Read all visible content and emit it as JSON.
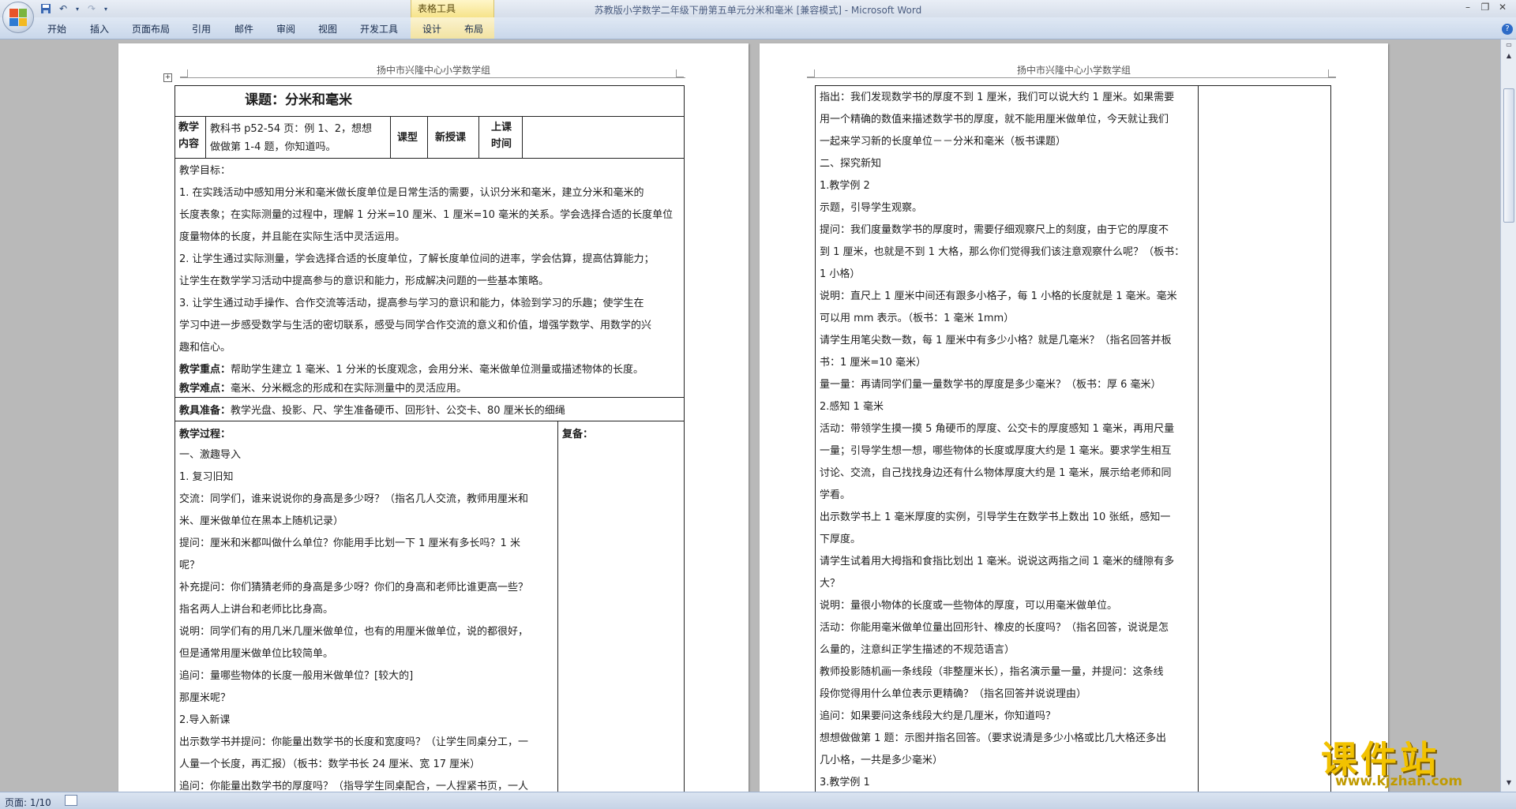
{
  "window": {
    "title": "苏教版小学数学二年级下册第五单元分米和毫米 [兼容模式] - Microsoft Word",
    "context_tab_group": "表格工具"
  },
  "ribbon": {
    "tabs": [
      "开始",
      "插入",
      "页面布局",
      "引用",
      "邮件",
      "审阅",
      "视图",
      "开发工具",
      "设计",
      "布局"
    ]
  },
  "page1": {
    "header": "扬中市兴隆中心小学数学组",
    "title": "课题：分米和毫米",
    "row2": {
      "label_a": "教学",
      "label_b": "内容",
      "content_a": "教科书 p52-54 页：例 1、2，想想",
      "content_b": "做做第 1-4 题，你知道吗。",
      "lesson_type_label": "课型",
      "lesson_type_value": "新授课",
      "time_label_a": "上课",
      "time_label_b": "时间"
    },
    "objectives_heading": "教学目标：",
    "objectives": [
      "1. 在实践活动中感知用分米和毫米做长度单位是日常生活的需要，认识分米和毫米，建立分米和毫米的",
      "长度表象；在实际测量的过程中，理解 1 分米=10 厘米、1 厘米=10 毫米的关系。学会选择合适的长度单位",
      "度量物体的长度，并且能在实际生活中灵活运用。",
      "2. 让学生通过实际测量，学会选择合适的长度单位，了解长度单位间的进率，学会估算，提高估算能力；",
      "让学生在数学学习活动中提高参与的意识和能力，形成解决问题的一些基本策略。",
      "3. 让学生通过动手操作、合作交流等活动，提高参与学习的意识和能力，体验到学习的乐趣；使学生在",
      "学习中进一步感受数学与生活的密切联系，感受与同学合作交流的意义和价值，增强学数学、用数学的兴",
      "趣和信心。"
    ],
    "key_point_label": "教学重点：",
    "key_point": "帮助学生建立 1 毫米、1 分米的长度观念，会用分米、毫米做单位测量或描述物体的长度。",
    "difficulty_label": "教学难点：",
    "difficulty": "毫米、分米概念的形成和在实际测量中的灵活应用。",
    "prep_label": "教具准备：",
    "prep": "教学光盘、投影、尺、学生准备硬币、回形针、公交卡、80 厘米长的细绳",
    "process_label": "教学过程：",
    "review_label": "复备：",
    "process": [
      "一、激趣导入",
      "1. 复习旧知",
      "交流：同学们，谁来说说你的身高是多少呀？（指名几人交流，教师用厘米和",
      "米、厘米做单位在黑本上随机记录）",
      "提问：厘米和米都叫做什么单位？你能用手比划一下  1  厘米有多长吗？1 米",
      "呢？",
      "补充提问：你们猜猜老师的身高是多少呀？你们的身高和老师比谁更高一些？",
      "指名两人上讲台和老师比比身高。",
      "说明：同学们有的用几米几厘米做单位，也有的用厘米做单位，说的都很好，",
      "但是通常用厘米做单位比较简单。",
      "追问：量哪些物体的长度一般用米做单位？[较大的]",
      "那厘米呢？",
      "2.导入新课",
      "出示数学书并提问：你能量出数学书的长度和宽度吗？（让学生同桌分工，一",
      "人量一个长度，再汇报）（板书：数学书长 24 厘米、宽 17 厘米）",
      "追问：你能量出数学书的厚度吗？（指导学生同桌配合，一人捏紧书页，一人"
    ]
  },
  "page2": {
    "header": "扬中市兴隆中心小学数学组",
    "lines": [
      "指出：我们发现数学书的厚度不到 1 厘米，我们可以说大约 1 厘米。如果需要",
      "用一个精确的数值来描述数学书的厚度，就不能用厘米做单位，今天就让我们",
      "一起来学习新的长度单位－－分米和毫米（板书课题）",
      "二、探究新知",
      "1.教学例 2",
      "示题，引导学生观察。",
      "提问：我们度量数学书的厚度时，需要仔细观察尺上的刻度，由于它的厚度不",
      "到 1 厘米，也就是不到 1 大格，那么你们觉得我们该注意观察什么呢？（板书：",
      "1 小格）",
      "说明：直尺上 1 厘米中间还有跟多小格子，每 1 小格的长度就是 1 毫米。毫米",
      "可以用 mm 表示。（板书：1 毫米   1mm）",
      "请学生用笔尖数一数，每 1 厘米中有多少小格？就是几毫米？（指名回答并板",
      "书：1 厘米=10 毫米）",
      "量一量：再请同学们量一量数学书的厚度是多少毫米？（板书：厚 6 毫米）",
      "2.感知 1 毫米",
      "活动：带领学生摸一摸 5 角硬币的厚度、公交卡的厚度感知 1 毫米，再用尺量",
      "一量；引导学生想一想，哪些物体的长度或厚度大约是 1 毫米。要求学生相互",
      "讨论、交流，自己找找身边还有什么物体厚度大约是 1 毫米，展示给老师和同",
      "学看。",
      "出示数学书上 1 毫米厚度的实例，引导学生在数学书上数出 10 张纸，感知一",
      "下厚度。",
      "请学生试着用大拇指和食指比划出 1 毫米。说说这两指之间 1 毫米的缝隙有多",
      "大？",
      "说明：量很小物体的长度或一些物体的厚度，可以用毫米做单位。",
      "活动：你能用毫米做单位量出回形针、橡皮的长度吗？（指名回答，说说是怎",
      "么量的，注意纠正学生描述的不规范语言）",
      "教师投影随机画一条线段（非整厘米长），指名演示量一量，并提问：这条线",
      "段你觉得用什么单位表示更精确？（指名回答并说说理由）",
      "追问：如果要问这条线段大约是几厘米，你知道吗？",
      "想想做做第 1 题：示图并指名回答。（要求说清是多少小格或比几大格还多出",
      "几小格，一共是多少毫米）",
      "3.教学例 1"
    ]
  },
  "statusbar": {
    "page_indicator": "页面: 1/10"
  },
  "watermark": {
    "title": "课件站",
    "url": "www.kjzhan.com"
  }
}
